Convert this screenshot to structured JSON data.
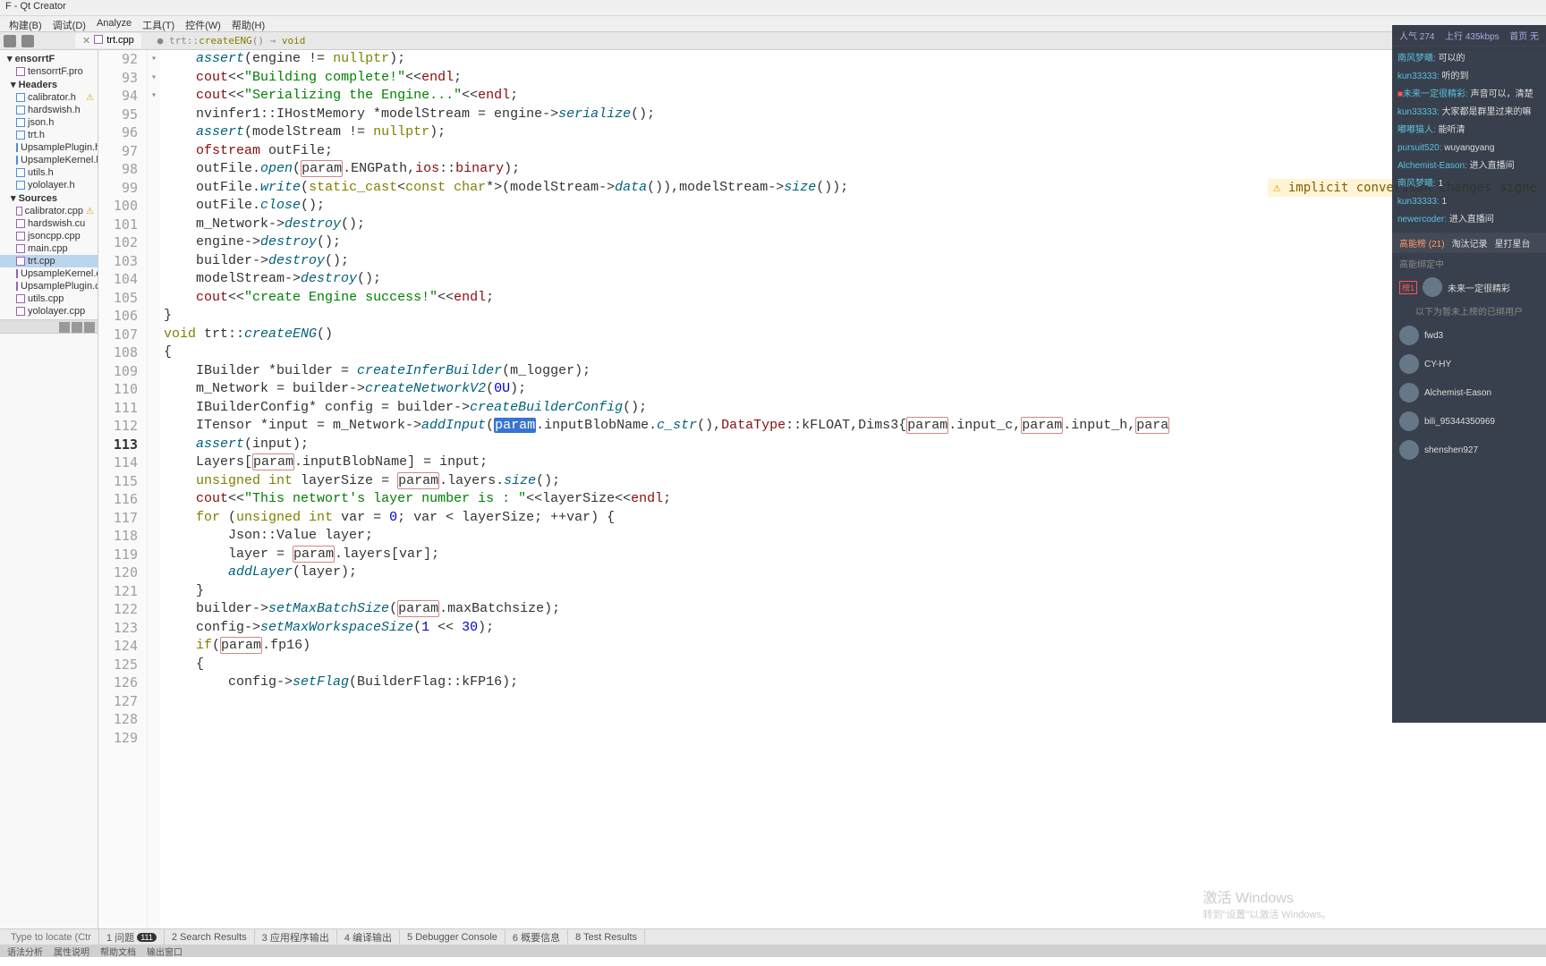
{
  "window": {
    "title": "F - Qt Creator"
  },
  "menu": {
    "items": [
      "构建(B)",
      "调试(D)",
      "Analyze",
      "工具(T)",
      "控件(W)",
      "帮助(H)"
    ]
  },
  "tabs": [
    {
      "label": "trt.cpp",
      "active": true
    },
    {
      "label": "trt::createENG() -> void",
      "active": false
    }
  ],
  "breadcrumb": "trt::createENG() -> void",
  "project": {
    "root": "ensorrtF",
    "items": [
      {
        "label": "tensorrtF.pro",
        "type": "pro"
      },
      {
        "label": "Headers",
        "type": "folder"
      },
      {
        "label": "calibrator.h",
        "type": "h",
        "warn": true
      },
      {
        "label": "hardswish.h",
        "type": "h"
      },
      {
        "label": "json.h",
        "type": "h"
      },
      {
        "label": "trt.h",
        "type": "h"
      },
      {
        "label": "UpsamplePlugin.h",
        "type": "h"
      },
      {
        "label": "UpsampleKernel.h",
        "type": "h"
      },
      {
        "label": "utils.h",
        "type": "h"
      },
      {
        "label": "yololayer.h",
        "type": "h"
      },
      {
        "label": "Sources",
        "type": "folder"
      },
      {
        "label": "calibrator.cpp",
        "type": "c",
        "warn": true
      },
      {
        "label": "hardswish.cu",
        "type": "c"
      },
      {
        "label": "jsoncpp.cpp",
        "type": "c"
      },
      {
        "label": "main.cpp",
        "type": "c"
      },
      {
        "label": "trt.cpp",
        "type": "c",
        "selected": true
      },
      {
        "label": "UpsampleKernel.cu",
        "type": "c"
      },
      {
        "label": "UpsamplePlugin.cpp",
        "type": "c"
      },
      {
        "label": "utils.cpp",
        "type": "c"
      },
      {
        "label": "yololayer.cpp",
        "type": "c"
      }
    ]
  },
  "code_lines": [
    92,
    93,
    94,
    95,
    96,
    97,
    98,
    99,
    100,
    101,
    102,
    103,
    104,
    105,
    106,
    107,
    108,
    109,
    110,
    111,
    112,
    113,
    114,
    115,
    116,
    117,
    118,
    119,
    120,
    121,
    122,
    123,
    124,
    125,
    126,
    127,
    128,
    129
  ],
  "current_line": 113,
  "fold_lines": [
    107,
    119,
    127
  ],
  "code": {
    "92": [
      [
        "",
        "    "
      ],
      [
        "fn",
        "assert"
      ],
      [
        "op",
        "(engine != "
      ],
      [
        "kw",
        "nullptr"
      ],
      [
        "op",
        ");"
      ]
    ],
    "93": [
      [
        "",
        "    "
      ],
      [
        "id",
        "cout"
      ],
      [
        "op",
        "<<"
      ],
      [
        "str",
        "\"Building complete!\""
      ],
      [
        "op",
        "<<"
      ],
      [
        "id",
        "endl"
      ],
      [
        "op",
        ";"
      ]
    ],
    "94": [
      [
        "",
        "    "
      ],
      [
        "id",
        "cout"
      ],
      [
        "op",
        "<<"
      ],
      [
        "str",
        "\"Serializing the Engine...\""
      ],
      [
        "op",
        "<<"
      ],
      [
        "id",
        "endl"
      ],
      [
        "op",
        ";"
      ]
    ],
    "95": [
      [
        "",
        "    nvinfer1::IHostMemory *modelStream = engine->"
      ],
      [
        "fn",
        "serialize"
      ],
      [
        "op",
        "();"
      ]
    ],
    "96": [
      [
        "",
        "    "
      ],
      [
        "fn",
        "assert"
      ],
      [
        "op",
        "(modelStream != "
      ],
      [
        "kw",
        "nullptr"
      ],
      [
        "op",
        ");"
      ]
    ],
    "97": [
      [
        "",
        "    "
      ],
      [
        "id",
        "ofstream"
      ],
      [
        "op",
        " outFile;"
      ]
    ],
    "98": [
      [
        "",
        "    outFile."
      ],
      [
        "fn",
        "open"
      ],
      [
        "op",
        "("
      ],
      [
        "box",
        "param"
      ],
      [
        "op",
        ".ENGPath,"
      ],
      [
        "id",
        "ios"
      ],
      [
        "op",
        "::"
      ],
      [
        "id",
        "binary"
      ],
      [
        "op",
        ");"
      ]
    ],
    "99": [
      [
        "",
        "    outFile."
      ],
      [
        "fn",
        "write"
      ],
      [
        "op",
        "("
      ],
      [
        "kw",
        "static_cast"
      ],
      [
        "op",
        "<"
      ],
      [
        "kw",
        "const char"
      ],
      [
        "op",
        "*>(modelStream->"
      ],
      [
        "fn",
        "data"
      ],
      [
        "op",
        "()),modelStream->"
      ],
      [
        "fn",
        "size"
      ],
      [
        "op",
        "());"
      ]
    ],
    "100": [
      [
        "",
        "    outFile."
      ],
      [
        "fn",
        "close"
      ],
      [
        "op",
        "();"
      ]
    ],
    "101": [
      [
        "",
        "    m_Network->"
      ],
      [
        "fn",
        "destroy"
      ],
      [
        "op",
        "();"
      ]
    ],
    "102": [
      [
        "",
        "    engine->"
      ],
      [
        "fn",
        "destroy"
      ],
      [
        "op",
        "();"
      ]
    ],
    "103": [
      [
        "",
        "    builder->"
      ],
      [
        "fn",
        "destroy"
      ],
      [
        "op",
        "();"
      ]
    ],
    "104": [
      [
        "",
        "    modelStream->"
      ],
      [
        "fn",
        "destroy"
      ],
      [
        "op",
        "();"
      ]
    ],
    "105": [
      [
        "",
        "    "
      ],
      [
        "id",
        "cout"
      ],
      [
        "op",
        "<<"
      ],
      [
        "str",
        "\"create Engine success!\""
      ],
      [
        "op",
        "<<"
      ],
      [
        "id",
        "endl"
      ],
      [
        "op",
        ";"
      ]
    ],
    "106": [
      [
        "op",
        "}"
      ]
    ],
    "107": [
      [
        "kw",
        "void"
      ],
      [
        "op",
        " trt::"
      ],
      [
        "fn",
        "createENG"
      ],
      [
        "op",
        "()"
      ]
    ],
    "108": [
      [
        "op",
        "{"
      ]
    ],
    "109": [
      [
        "",
        ""
      ]
    ],
    "110": [
      [
        "",
        "    IBuilder *builder = "
      ],
      [
        "fn",
        "createInferBuilder"
      ],
      [
        "op",
        "(m_logger);"
      ]
    ],
    "111": [
      [
        "",
        "    m_Network = builder->"
      ],
      [
        "fn",
        "createNetworkV2"
      ],
      [
        "op",
        "("
      ],
      [
        "num",
        "0U"
      ],
      [
        "op",
        ");"
      ]
    ],
    "112": [
      [
        "",
        "    IBuilderConfig* config = builder->"
      ],
      [
        "fn",
        "createBuilderConfig"
      ],
      [
        "op",
        "();"
      ]
    ],
    "113": [
      [
        "",
        "    ITensor *input = m_Network->"
      ],
      [
        "fn",
        "addInput"
      ],
      [
        "op",
        "("
      ],
      [
        "sel",
        "param"
      ],
      [
        "op",
        ".inputBlobName."
      ],
      [
        "fn",
        "c_str"
      ],
      [
        "op",
        "(),"
      ],
      [
        "id",
        "DataType"
      ],
      [
        "op",
        "::kFLOAT,Dims3{"
      ],
      [
        "box",
        "param"
      ],
      [
        "op",
        ".input_c,"
      ],
      [
        "box",
        "param"
      ],
      [
        "op",
        ".input_h,"
      ],
      [
        "box",
        "para"
      ]
    ],
    "114": [
      [
        "",
        "    "
      ],
      [
        "fn",
        "assert"
      ],
      [
        "op",
        "(input);"
      ]
    ],
    "115": [
      [
        "",
        "    Layers["
      ],
      [
        "box",
        "param"
      ],
      [
        "op",
        ".inputBlobName] = input;"
      ]
    ],
    "116": [
      [
        "",
        "    "
      ],
      [
        "kw",
        "unsigned int"
      ],
      [
        "op",
        " layerSize = "
      ],
      [
        "box",
        "param"
      ],
      [
        "op",
        ".layers."
      ],
      [
        "fn",
        "size"
      ],
      [
        "op",
        "();"
      ]
    ],
    "117": [
      [
        "",
        "    "
      ],
      [
        "id",
        "cout"
      ],
      [
        "op",
        "<<"
      ],
      [
        "str",
        "\"This networt's layer number is : \""
      ],
      [
        "op",
        "<<layerSize<<"
      ],
      [
        "id",
        "endl"
      ],
      [
        "op",
        ";"
      ]
    ],
    "118": [
      [
        "",
        ""
      ]
    ],
    "119": [
      [
        "",
        "    "
      ],
      [
        "kw",
        "for"
      ],
      [
        "op",
        " ("
      ],
      [
        "kw",
        "unsigned int"
      ],
      [
        "op",
        " var = "
      ],
      [
        "num",
        "0"
      ],
      [
        "op",
        "; var < layerSize; ++var) {"
      ]
    ],
    "120": [
      [
        "",
        "        Json::Value layer;"
      ]
    ],
    "121": [
      [
        "",
        "        layer = "
      ],
      [
        "box",
        "param"
      ],
      [
        "op",
        ".layers[var];"
      ]
    ],
    "122": [
      [
        "",
        "        "
      ],
      [
        "fn",
        "addLayer"
      ],
      [
        "op",
        "(layer);"
      ]
    ],
    "123": [
      [
        "",
        "    }"
      ]
    ],
    "124": [
      [
        "",
        ""
      ]
    ],
    "125": [
      [
        "",
        "    builder->"
      ],
      [
        "fn",
        "setMaxBatchSize"
      ],
      [
        "op",
        "("
      ],
      [
        "box",
        "param"
      ],
      [
        "op",
        ".maxBatchsize);"
      ]
    ],
    "126": [
      [
        "",
        "    config->"
      ],
      [
        "fn",
        "setMaxWorkspaceSize"
      ],
      [
        "op",
        "("
      ],
      [
        "num",
        "1"
      ],
      [
        "op",
        " << "
      ],
      [
        "num",
        "30"
      ],
      [
        "op",
        ");"
      ]
    ],
    "127": [
      [
        "",
        "    "
      ],
      [
        "kw",
        "if"
      ],
      [
        "op",
        "("
      ],
      [
        "box",
        "param"
      ],
      [
        "op",
        ".fp16)"
      ]
    ],
    "128": [
      [
        "",
        "    {"
      ]
    ],
    "129": [
      [
        "",
        "        config->"
      ],
      [
        "fn",
        "setFlag"
      ],
      [
        "op",
        "(BuilderFlag::kFP16);"
      ]
    ]
  },
  "warning": {
    "line": 99,
    "text": "implicit conversion changes signe"
  },
  "status": {
    "locator_placeholder": "Type to locate (Ctrl+K)",
    "panels": [
      "1  问题",
      "2  Search Results",
      "3  应用程序输出",
      "4  编译输出",
      "5  Debugger Console",
      "6  概要信息",
      "8  Test Results"
    ],
    "badge": "111"
  },
  "extra_tabs": [
    "语法分析",
    "属性说明",
    "帮助文档",
    "输出窗口"
  ],
  "overlay": {
    "stats": {
      "popularity_label": "人气",
      "popularity": "274",
      "uplink_label": "上行",
      "uplink": "435kbps",
      "home": "首页 无"
    },
    "chat": [
      {
        "u": "南风梦曦",
        "m": "可以的"
      },
      {
        "u": "kun33333",
        "m": "听的到"
      },
      {
        "u": "未来一定很精彩",
        "m": "声音可以，清楚",
        "badge": true
      },
      {
        "u": "kun33333",
        "m": "大家都是群里过来的嘛"
      },
      {
        "u": "嘟嘟猫人",
        "m": "能听清"
      },
      {
        "u": "pursuit520",
        "m": "wuyangyang"
      },
      {
        "u": "Alchemist-Eason",
        "m": "进入直播间"
      },
      {
        "u": "南风梦曦",
        "m": "1"
      },
      {
        "u": "kun33333",
        "m": "1"
      },
      {
        "u": "newercoder",
        "m": "进入直播间"
      }
    ],
    "tabs": [
      {
        "label": "高能榜 (21)",
        "active": true
      },
      {
        "label": "淘汰记录"
      },
      {
        "label": "星打星台"
      }
    ],
    "subtitle": "高能绑定中",
    "top_user": "未来一定很精彩",
    "note": "以下为暂未上榜的已绑用户",
    "users": [
      "fwd3",
      "CY-HY",
      "Alchemist-Eason",
      "bili_95344350969",
      "shenshen927"
    ]
  },
  "watermark": {
    "line1": "激活 Windows",
    "line2": "转到\"设置\"以激活 Windows。"
  }
}
